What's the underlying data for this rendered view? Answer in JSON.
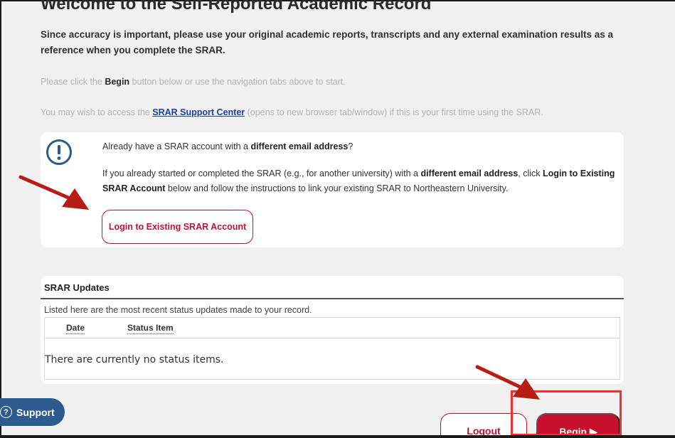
{
  "page": {
    "title": "Welcome to the Self-Reported Academic Record",
    "intro": "Since accuracy is important, please use your original academic reports, transcripts and any external examination results as a reference when you complete the SRAR.",
    "begin_line": {
      "prefix": "Please click the ",
      "bold": "Begin",
      "suffix": " button below or use the navigation tabs above to start."
    },
    "support_line": {
      "prefix": "You may wish to access the ",
      "link": "SRAR Support Center",
      "suffix": " (opens to new browser tab/window) if this is your first time using the SRAR."
    }
  },
  "notice": {
    "icon": "exclamation-circle-icon",
    "line1_prefix": "Already have a SRAR account with a ",
    "line1_bold": "different email address",
    "line1_suffix": "?",
    "para_prefix": "If you already started or completed the SRAR (e.g., for another university) with a ",
    "para_bold1": "different email address",
    "para_mid": ", click ",
    "para_bold2": "Login to Existing SRAR Account",
    "para_suffix": " below and follow the instructions to link your existing SRAR to Northeastern University.",
    "login_button": "Login to Existing SRAR Account"
  },
  "updates": {
    "header": "SRAR Updates",
    "description": "Listed here are the most recent status updates made to your record.",
    "columns": [
      "Date",
      "Status Item"
    ],
    "empty_message": "There are currently no status items."
  },
  "footer": {
    "support_label": "Support",
    "support_icon": "question-circle-icon",
    "logout_label": "Logout",
    "begin_label": "Begin ▶"
  },
  "colors": {
    "brand_red": "#c8102e",
    "link_blue": "#1c3fa8",
    "support_blue": "#2c5c8f",
    "annotation_red": "#ff2a2a",
    "arrow_red": "#b81c14"
  }
}
